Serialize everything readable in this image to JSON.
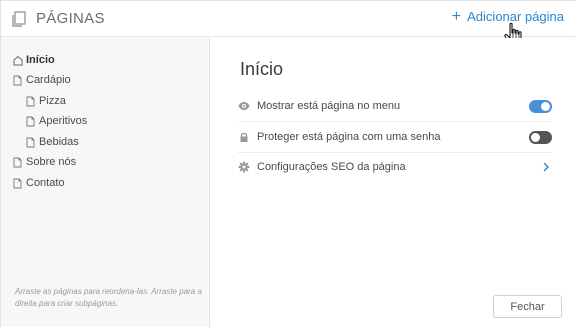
{
  "header": {
    "title": "PÁGINAS",
    "add_page_label": "Adicionar página"
  },
  "sidebar": {
    "items": [
      {
        "label": "Início",
        "level": 0,
        "icon": "home-icon",
        "active": true
      },
      {
        "label": "Cardápio",
        "level": 0,
        "icon": "page-icon",
        "active": false
      },
      {
        "label": "Pizza",
        "level": 1,
        "icon": "page-icon",
        "active": false
      },
      {
        "label": "Aperitivos",
        "level": 1,
        "icon": "page-icon",
        "active": false
      },
      {
        "label": "Bebidas",
        "level": 1,
        "icon": "page-icon",
        "active": false
      },
      {
        "label": "Sobre nós",
        "level": 0,
        "icon": "page-icon",
        "active": false
      },
      {
        "label": "Contato",
        "level": 0,
        "icon": "page-icon",
        "active": false
      }
    ],
    "hint": "Arraste as páginas para reordena-las. Arraste para a direita para criar subpáginas."
  },
  "main": {
    "title": "Início",
    "settings": [
      {
        "label": "Mostrar está página no menu",
        "icon": "eye-icon",
        "control": "toggle",
        "on": true
      },
      {
        "label": "Proteger está página com uma senha",
        "icon": "lock-icon",
        "control": "toggle",
        "on": false
      },
      {
        "label": "Configurações SEO da página",
        "icon": "gear-icon",
        "control": "chevron"
      }
    ],
    "close_label": "Fechar"
  },
  "colors": {
    "accent": "#2a87d0",
    "toggle_on": "#4a90d9",
    "toggle_off": "#555555"
  }
}
